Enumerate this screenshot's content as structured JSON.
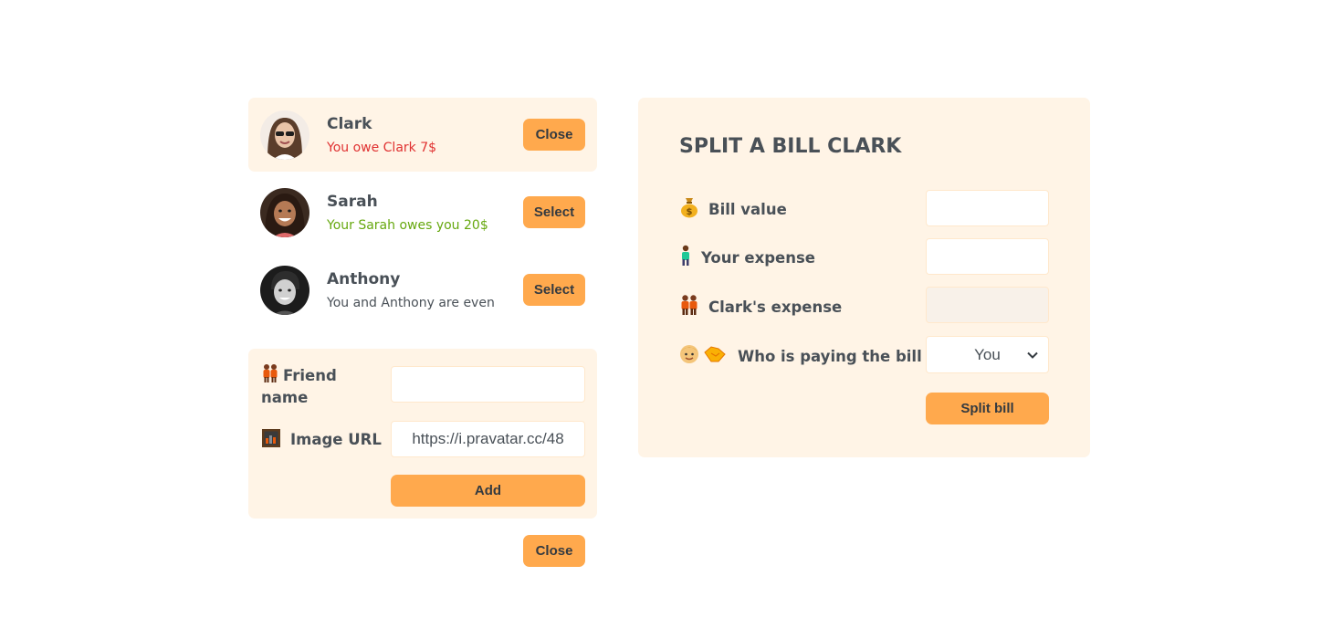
{
  "friends": [
    {
      "name": "Clark",
      "status": "You owe Clark 7$",
      "status_type": "owe",
      "button": "Close",
      "selected": true
    },
    {
      "name": "Sarah",
      "status": "Your Sarah owes you 20$",
      "status_type": "owed",
      "button": "Select",
      "selected": false
    },
    {
      "name": "Anthony",
      "status": "You and Anthony are even",
      "status_type": "even",
      "button": "Select",
      "selected": false
    }
  ],
  "add_form": {
    "friend_name_label": "Friend name",
    "friend_name_value": "",
    "image_url_label": "Image URL",
    "image_url_value": "https://i.pravatar.cc/48",
    "add_button": "Add"
  },
  "close_button": "Close",
  "split_form": {
    "title": "SPLIT A BILL CLARK",
    "bill_value_label": "Bill value",
    "bill_value": "",
    "your_expense_label": "Your expense",
    "your_expense": "",
    "friend_expense_label": "Clark's expense",
    "friend_expense": "",
    "payer_label": "Who is paying the bill",
    "payer_selected": "You",
    "split_button": "Split bill"
  },
  "icons": {
    "bill_value": "money-bag-icon",
    "your_expense": "person-standing-icon",
    "friend_expense": "couple-icon",
    "payer": "face-with-handshake-icon",
    "friend_name": "couple-icon",
    "image_url": "framed-picture-icon"
  },
  "colors": {
    "accent": "#ffa94d",
    "panel_bg": "#fff4e6",
    "owe": "#e03131",
    "owed": "#66a80f",
    "text": "#495057"
  }
}
